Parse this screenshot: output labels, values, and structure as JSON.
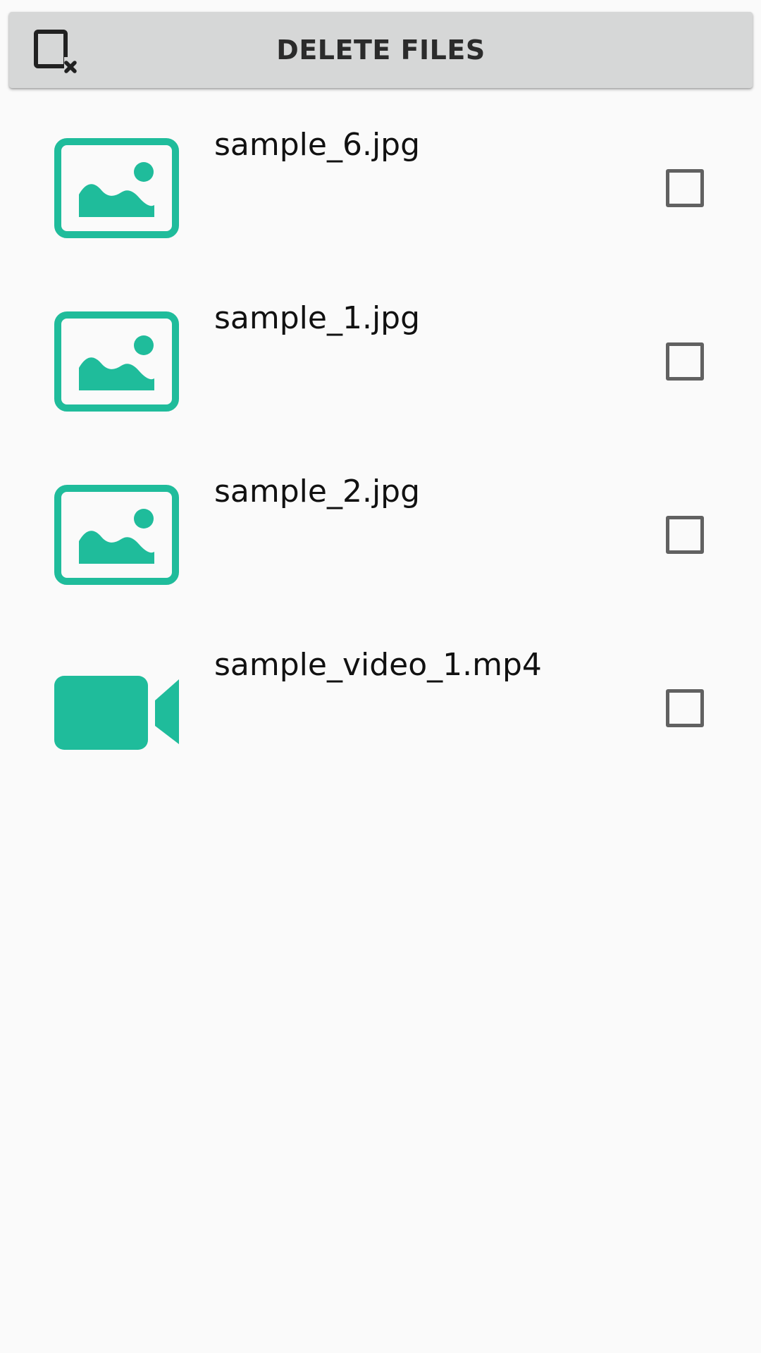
{
  "header": {
    "delete_label": "DELETE FILES",
    "icon": "deselect-icon"
  },
  "colors": {
    "accent": "#1fbc9b",
    "bar_background": "#d6d7d7",
    "page_background": "#fafafa",
    "checkbox_border": "#616161"
  },
  "files": [
    {
      "name": "sample_6.jpg",
      "type": "image",
      "icon": "image-icon",
      "checked": false
    },
    {
      "name": "sample_1.jpg",
      "type": "image",
      "icon": "image-icon",
      "checked": false
    },
    {
      "name": "sample_2.jpg",
      "type": "image",
      "icon": "image-icon",
      "checked": false
    },
    {
      "name": "sample_video_1.mp4",
      "type": "video",
      "icon": "video-icon",
      "checked": false
    }
  ]
}
